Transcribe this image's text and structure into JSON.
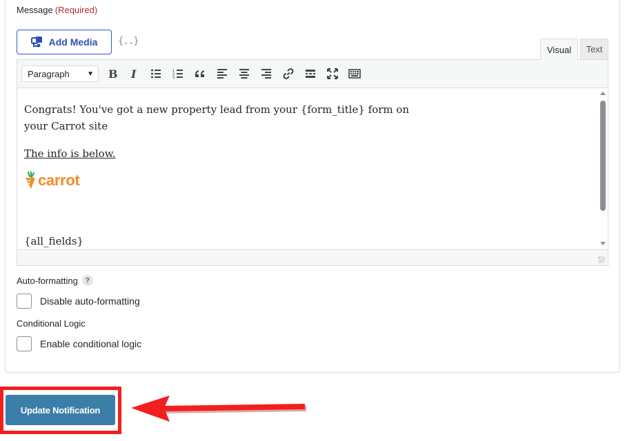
{
  "message_field": {
    "label": "Message",
    "required_label": "(Required)"
  },
  "media": {
    "add_media_label": "Add Media",
    "merge_tag_icon": "merge-tags-icon"
  },
  "tabs": [
    {
      "label": "Visual",
      "active": true
    },
    {
      "label": "Text",
      "active": false
    }
  ],
  "toolbar": {
    "format_select_value": "Paragraph",
    "buttons": [
      "bold",
      "italic",
      "bulleted-list",
      "numbered-list",
      "blockquote",
      "align-left",
      "align-center",
      "align-right",
      "link",
      "read-more",
      "fullscreen",
      "toolbar-toggle"
    ]
  },
  "editor": {
    "line1": "Congrats!  You've got a new property lead from your {form_title} form on",
    "line2": "your Carrot site",
    "info_line": "The info is below.",
    "logo_text": "carrot",
    "all_fields": "{all_fields}"
  },
  "auto_formatting": {
    "label": "Auto-formatting",
    "help_glyph": "?",
    "checkbox_label": "Disable auto-formatting",
    "checked": false
  },
  "conditional_logic": {
    "label": "Conditional Logic",
    "checkbox_label": "Enable conditional logic",
    "checked": false
  },
  "update_button_label": "Update Notification",
  "colors": {
    "accent_blue": "#2b4fb6",
    "update_button": "#3b7ea7",
    "highlight_red": "#f21f1f",
    "required_red": "#b32d2e",
    "carrot_orange": "#f28c28"
  }
}
